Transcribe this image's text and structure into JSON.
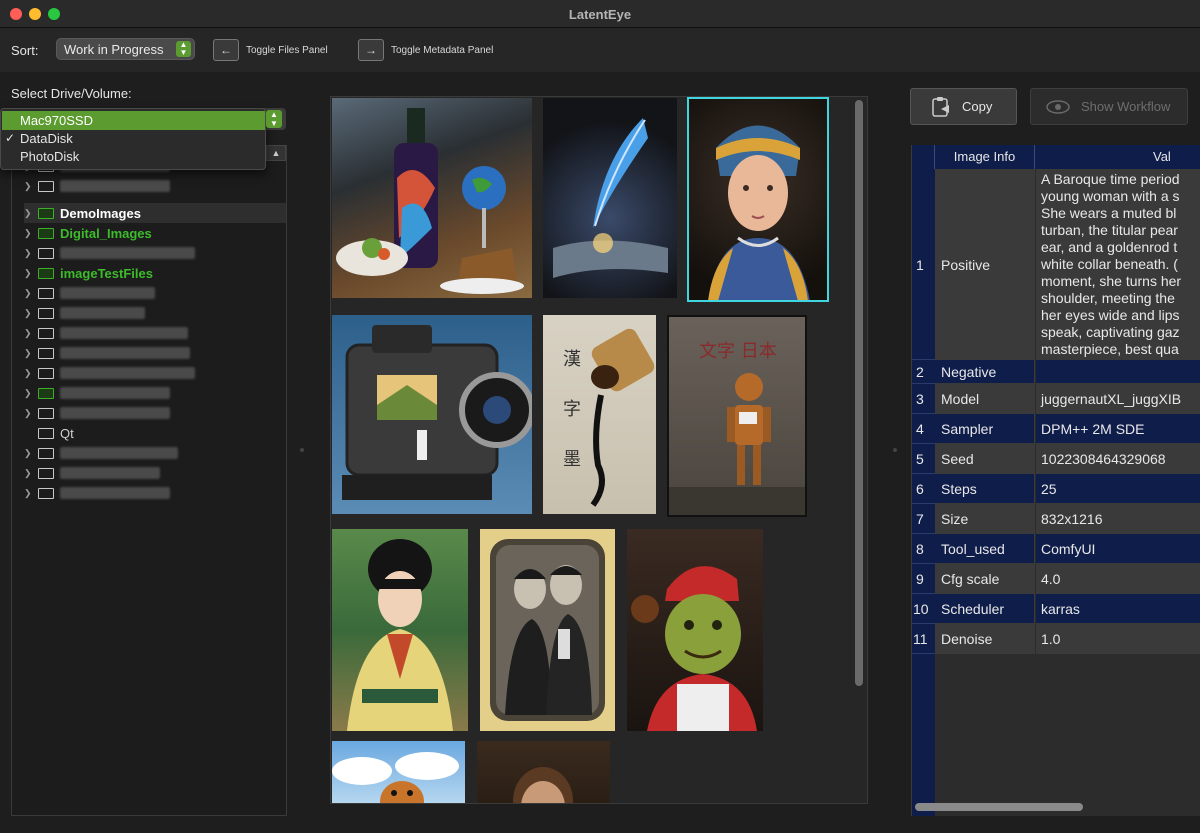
{
  "window": {
    "title": "LatentEye"
  },
  "toolbar": {
    "sort_label": "Sort:",
    "sort_value": "Work in Progress",
    "toggle_files_label": "Toggle Files Panel",
    "toggle_metadata_label": "Toggle Metadata Panel"
  },
  "drive": {
    "label": "Select Drive/Volume:",
    "options": [
      "Mac970SSD",
      "DataDisk",
      "PhotoDisk"
    ],
    "selected": "Mac970SSD",
    "checked": "DataDisk"
  },
  "tree": {
    "items": [
      "DemoImages",
      "Digital_Images",
      "imageTestFiles",
      "Qt"
    ]
  },
  "actions": {
    "copy_label": "Copy",
    "workflow_label": "Show Workflow"
  },
  "metadata": {
    "header_info": "Image Info",
    "header_value": "Val",
    "rows": [
      {
        "idx": "1",
        "key": "Positive",
        "value": "A Baroque time period\nyoung woman with a s\nShe wears a muted bl\nturban, the titular pear\near, and a goldenrod t\nwhite collar beneath. (\nmoment, she turns her\nshoulder, meeting the\nher eyes wide and lips\nspeak, captivating gaz\nmasterpiece, best qua"
      },
      {
        "idx": "2",
        "key": "Negative",
        "value": ""
      },
      {
        "idx": "3",
        "key": "Model",
        "value": "juggernautXL_juggXIB"
      },
      {
        "idx": "4",
        "key": "Sampler",
        "value": "DPM++ 2M SDE"
      },
      {
        "idx": "5",
        "key": "Seed",
        "value": "1022308464329068"
      },
      {
        "idx": "6",
        "key": "Steps",
        "value": "25"
      },
      {
        "idx": "7",
        "key": "Size",
        "value": "832x1216"
      },
      {
        "idx": "8",
        "key": "Tool_used",
        "value": "ComfyUI"
      },
      {
        "idx": "9",
        "key": "Cfg scale",
        "value": "4.0"
      },
      {
        "idx": "10",
        "key": "Scheduler",
        "value": "karras"
      },
      {
        "idx": "11",
        "key": "Denoise",
        "value": "1.0"
      }
    ]
  },
  "colors": {
    "accent_green": "#5b9b2f",
    "selection_cyan": "#3fd6e0",
    "table_blue": "#0f1d4a"
  }
}
